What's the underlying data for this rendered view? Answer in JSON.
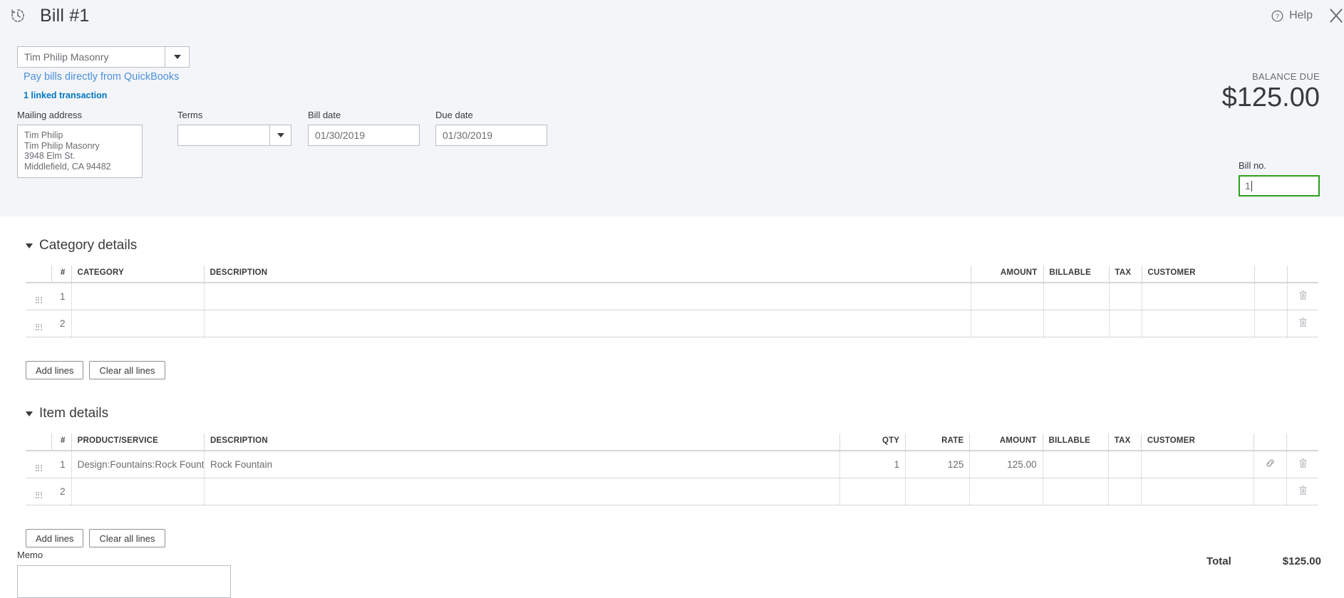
{
  "header": {
    "history_icon": "history-clock-icon",
    "title": "Bill #1",
    "help_label": "Help",
    "help_icon": "question-circle-icon",
    "close_icon": "close-x-icon"
  },
  "vendor": {
    "value": "Tim Philip Masonry",
    "caret_icon": "chevron-down-icon",
    "pay_link": "Pay bills directly from QuickBooks",
    "linked_transaction": "1 linked transaction"
  },
  "balance": {
    "label": "BALANCE DUE",
    "amount": "$125.00"
  },
  "fields": {
    "mailing_address_label": "Mailing address",
    "mailing_address_value": "Tim Philip\nTim Philip Masonry\n3948 Elm St.\nMiddlefield, CA  94482",
    "mailing_address_lines": [
      "Tim Philip",
      "Tim Philip Masonry",
      "3948 Elm St.",
      "Middlefield, CA  94482"
    ],
    "terms_label": "Terms",
    "terms_value": "",
    "bill_date_label": "Bill date",
    "bill_date_value": "01/30/2019",
    "due_date_label": "Due date",
    "due_date_value": "01/30/2019",
    "bill_no_label": "Bill no.",
    "bill_no_value": "1"
  },
  "category_details": {
    "title": "Category details",
    "columns": [
      "#",
      "CATEGORY",
      "DESCRIPTION",
      "AMOUNT",
      "BILLABLE",
      "TAX",
      "CUSTOMER"
    ],
    "rows": [
      {
        "num": "1",
        "category": "",
        "description": "",
        "amount": "",
        "billable": "",
        "tax": "",
        "customer": "",
        "link_icon": "",
        "delete_icon": "trash-icon"
      },
      {
        "num": "2",
        "category": "",
        "description": "",
        "amount": "",
        "billable": "",
        "tax": "",
        "customer": "",
        "link_icon": "",
        "delete_icon": "trash-icon"
      }
    ],
    "add_lines": "Add lines",
    "clear_all_lines": "Clear all lines"
  },
  "item_details": {
    "title": "Item details",
    "columns": [
      "#",
      "PRODUCT/SERVICE",
      "DESCRIPTION",
      "QTY",
      "RATE",
      "AMOUNT",
      "BILLABLE",
      "TAX",
      "CUSTOMER"
    ],
    "rows": [
      {
        "num": "1",
        "product": "Design:Fountains:Rock Founta",
        "description": "Rock Fountain",
        "qty": "1",
        "rate": "125",
        "amount": "125.00",
        "billable": "",
        "tax": "",
        "customer": "",
        "link_icon": "link-chain-icon",
        "delete_icon": "trash-icon"
      },
      {
        "num": "2",
        "product": "",
        "description": "",
        "qty": "",
        "rate": "",
        "amount": "",
        "billable": "",
        "tax": "",
        "customer": "",
        "link_icon": "",
        "delete_icon": "trash-icon"
      }
    ],
    "add_lines": "Add lines",
    "clear_all_lines": "Clear all lines"
  },
  "footer": {
    "memo_label": "Memo",
    "memo_value": "",
    "total_label": "Total",
    "total_value": "$125.00"
  },
  "colors": {
    "panel_bg": "#f4f5f8",
    "link_blue": "#0077c5",
    "focus_green": "#2ca01c",
    "text": "#393a3d"
  }
}
